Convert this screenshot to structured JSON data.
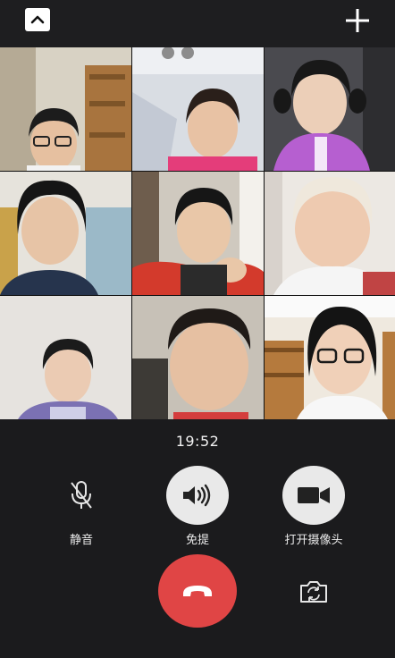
{
  "call": {
    "timer": "19:52",
    "controls": {
      "mute_label": "静音",
      "speaker_label": "免提",
      "camera_label": "打开摄像头"
    }
  },
  "icons": {
    "collapse": "chevron-up-icon",
    "add": "plus-icon",
    "mute": "microphone-icon",
    "speaker": "speaker-icon",
    "camera": "video-camera-icon",
    "hangup": "phone-hangup-icon",
    "flip": "camera-switch-icon"
  },
  "colors": {
    "hangup": "#e04545",
    "background": "#1b1b1d",
    "button_fill": "#e9e9e9"
  },
  "participants_count": 9
}
